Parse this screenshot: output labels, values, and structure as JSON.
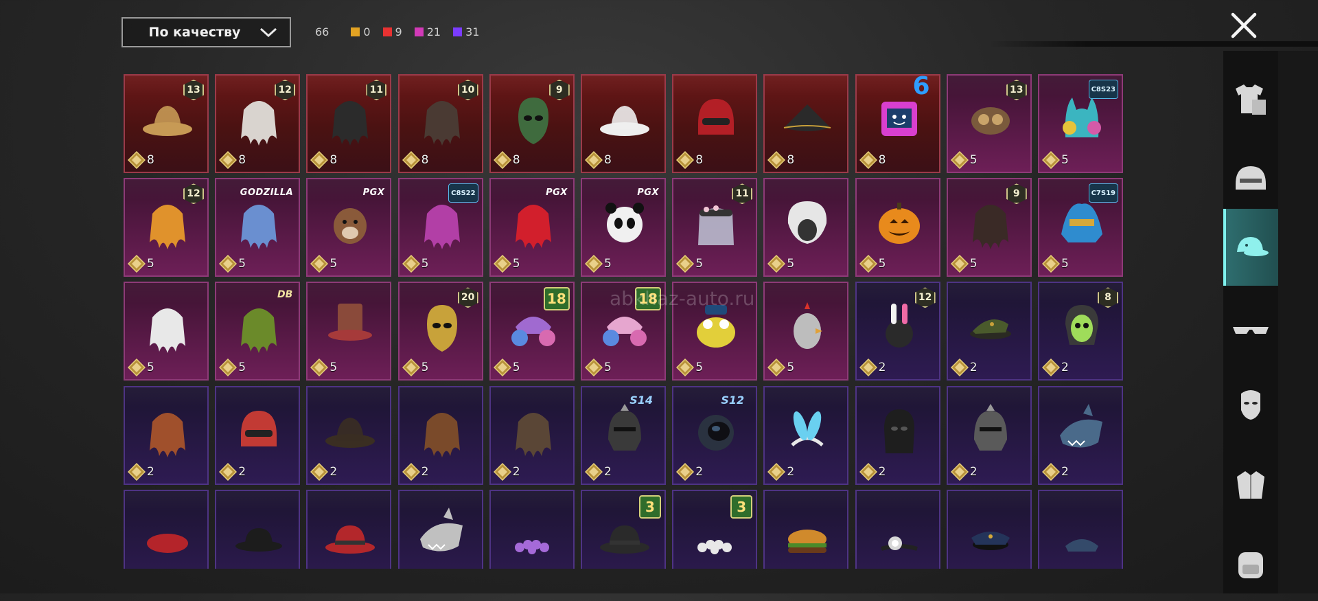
{
  "filter": {
    "label": "По качеству"
  },
  "counts": {
    "total": "66",
    "items": [
      {
        "color": "#e3a323",
        "value": "0"
      },
      {
        "color": "#e83232",
        "value": "9"
      },
      {
        "color": "#d23ab8",
        "value": "21"
      },
      {
        "color": "#7b3cff",
        "value": "31"
      }
    ]
  },
  "watermark": "abkhaz-auto.ru",
  "sidebar": {
    "items": [
      {
        "icon": "outfit-icon",
        "active": false
      },
      {
        "icon": "helmet-icon",
        "active": false
      },
      {
        "icon": "cap-icon",
        "active": true
      },
      {
        "icon": "glasses-icon",
        "active": false
      },
      {
        "icon": "face-icon",
        "active": false
      },
      {
        "icon": "jacket-icon",
        "active": false
      },
      {
        "icon": "backpack-icon",
        "active": false
      }
    ]
  },
  "grid": {
    "rows": [
      [
        {
          "quality": "red",
          "price": "8",
          "badge": "13",
          "badge_type": "level",
          "icon": "hat-icon",
          "color": "#c79a55"
        },
        {
          "quality": "red",
          "price": "8",
          "badge": "12",
          "badge_type": "level",
          "icon": "hair-icon",
          "color": "#d9d4cf"
        },
        {
          "quality": "red",
          "price": "8",
          "badge": "11",
          "badge_type": "level",
          "icon": "hair-icon",
          "color": "#2b2b2b"
        },
        {
          "quality": "red",
          "price": "8",
          "badge": "10",
          "badge_type": "level",
          "icon": "hair-icon",
          "color": "#4a3a33"
        },
        {
          "quality": "red",
          "price": "8",
          "badge": "9",
          "badge_type": "level",
          "icon": "mask-icon",
          "color": "#3f6b3e"
        },
        {
          "quality": "red",
          "price": "8",
          "badge": "",
          "badge_type": "",
          "icon": "hat-icon",
          "color": "#eeeeee"
        },
        {
          "quality": "red",
          "price": "8",
          "badge": "",
          "badge_type": "",
          "icon": "helmet-icon",
          "color": "#b31f26"
        },
        {
          "quality": "red",
          "price": "8",
          "badge": "",
          "badge_type": "",
          "icon": "tricorn-icon",
          "color": "#2a2a2a"
        },
        {
          "quality": "red",
          "price": "8",
          "badge": "6",
          "badge_type": "blue6",
          "icon": "box-head-icon",
          "color": "#d93fcf"
        },
        {
          "quality": "pink",
          "price": "5",
          "badge": "13",
          "badge_type": "level",
          "icon": "goggles-icon",
          "color": "#7a5a3c"
        },
        {
          "quality": "pink",
          "price": "5",
          "badge": "C8S23",
          "badge_type": "season",
          "icon": "cat-hood-icon",
          "color": "#3bb5c0"
        }
      ],
      [
        {
          "quality": "pink",
          "price": "5",
          "badge": "12",
          "badge_type": "level",
          "icon": "hair-icon",
          "color": "#e0922c"
        },
        {
          "quality": "pink",
          "price": "5",
          "badge": "GODZILLA",
          "badge_type": "logo",
          "icon": "hair-icon",
          "color": "#6a8fd0"
        },
        {
          "quality": "pink",
          "price": "5",
          "badge": "PGX",
          "badge_type": "logo",
          "icon": "animal-head-icon",
          "color": "#8a5a3a"
        },
        {
          "quality": "pink",
          "price": "5",
          "badge": "C8S22",
          "badge_type": "season",
          "icon": "hair-icon",
          "color": "#b23fa6"
        },
        {
          "quality": "pink",
          "price": "5",
          "badge": "PGX",
          "badge_type": "logo",
          "icon": "hair-icon",
          "color": "#d21f2c"
        },
        {
          "quality": "pink",
          "price": "5",
          "badge": "PGX",
          "badge_type": "logo",
          "icon": "panda-icon",
          "color": "#f0f0f0"
        },
        {
          "quality": "pink",
          "price": "5",
          "badge": "11",
          "badge_type": "level",
          "icon": "veil-icon",
          "color": "#bfc4d6"
        },
        {
          "quality": "pink",
          "price": "5",
          "badge": "",
          "badge_type": "",
          "icon": "fur-hat-icon",
          "color": "#e6e6e6"
        },
        {
          "quality": "pink",
          "price": "5",
          "badge": "",
          "badge_type": "",
          "icon": "pumpkin-icon",
          "color": "#e88a1c"
        },
        {
          "quality": "pink",
          "price": "5",
          "badge": "9",
          "badge_type": "level",
          "icon": "hair-icon",
          "color": "#3a2a26"
        },
        {
          "quality": "pink",
          "price": "5",
          "badge": "C7S19",
          "badge_type": "season",
          "icon": "headdress-icon",
          "color": "#2f8ccf"
        }
      ],
      [
        {
          "quality": "pink",
          "price": "5",
          "badge": "",
          "badge_type": "",
          "icon": "hair-icon",
          "color": "#e8e8e8"
        },
        {
          "quality": "pink",
          "price": "5",
          "badge": "DB",
          "badge_type": "logo2",
          "icon": "hair-icon",
          "color": "#6b8a2a"
        },
        {
          "quality": "pink",
          "price": "5",
          "badge": "",
          "badge_type": "",
          "icon": "top-hat-icon",
          "color": "#8a4a3a"
        },
        {
          "quality": "pink",
          "price": "5",
          "badge": "20",
          "badge_type": "level",
          "icon": "mask-icon",
          "color": "#c8a23a"
        },
        {
          "quality": "pink",
          "price": "5",
          "badge": "18",
          "badge_type": "big",
          "icon": "headphones-hat-icon",
          "color": "#a06ad0"
        },
        {
          "quality": "pink",
          "price": "5",
          "badge": "18",
          "badge_type": "big",
          "icon": "headphones-hat-icon",
          "color": "#e6a6cf"
        },
        {
          "quality": "pink",
          "price": "5",
          "badge": "",
          "badge_type": "",
          "icon": "frog-head-icon",
          "color": "#e2cf3a"
        },
        {
          "quality": "pink",
          "price": "5",
          "badge": "",
          "badge_type": "",
          "icon": "chicken-head-icon",
          "color": "#bdbdbd"
        },
        {
          "quality": "purple",
          "price": "2",
          "badge": "12",
          "badge_type": "level",
          "icon": "bunny-helmet-icon",
          "color": "#2a2a2a"
        },
        {
          "quality": "purple",
          "price": "2",
          "badge": "",
          "badge_type": "",
          "icon": "military-cap-icon",
          "color": "#4a5a2c"
        },
        {
          "quality": "purple",
          "price": "2",
          "badge": "8",
          "badge_type": "level",
          "icon": "skull-icon",
          "color": "#9fdc5a"
        }
      ],
      [
        {
          "quality": "purple",
          "price": "2",
          "badge": "",
          "badge_type": "",
          "icon": "hair-icon",
          "color": "#a0502c"
        },
        {
          "quality": "purple",
          "price": "2",
          "badge": "",
          "badge_type": "",
          "icon": "helmet-icon",
          "color": "#c23a34"
        },
        {
          "quality": "purple",
          "price": "2",
          "badge": "",
          "badge_type": "",
          "icon": "hat-icon",
          "color": "#3a2e22"
        },
        {
          "quality": "purple",
          "price": "2",
          "badge": "",
          "badge_type": "",
          "icon": "hair-icon",
          "color": "#7a4a2a"
        },
        {
          "quality": "purple",
          "price": "2",
          "badge": "",
          "badge_type": "",
          "icon": "hair-icon",
          "color": "#5a4636"
        },
        {
          "quality": "purple",
          "price": "2",
          "badge": "S14",
          "badge_type": "wing",
          "icon": "knight-helmet-icon",
          "color": "#3a3a3a"
        },
        {
          "quality": "purple",
          "price": "2",
          "badge": "S12",
          "badge_type": "wing",
          "icon": "space-helmet-icon",
          "color": "#2a3240"
        },
        {
          "quality": "purple",
          "price": "2",
          "badge": "",
          "badge_type": "",
          "icon": "bunny-ears-icon",
          "color": "#6ad0f0"
        },
        {
          "quality": "purple",
          "price": "2",
          "badge": "",
          "badge_type": "",
          "icon": "balaclava-icon",
          "color": "#1e1e1e"
        },
        {
          "quality": "purple",
          "price": "2",
          "badge": "",
          "badge_type": "",
          "icon": "knight-helmet-icon",
          "color": "#5a5a5a"
        },
        {
          "quality": "purple",
          "price": "2",
          "badge": "",
          "badge_type": "",
          "icon": "shark-hat-icon",
          "color": "#4a6a8a"
        }
      ],
      [
        {
          "quality": "purple",
          "price": "",
          "badge": "",
          "badge_type": "",
          "icon": "beret-icon",
          "color": "#b4242a"
        },
        {
          "quality": "purple",
          "price": "",
          "badge": "",
          "badge_type": "",
          "icon": "bowler-hat-icon",
          "color": "#1c1c1c"
        },
        {
          "quality": "purple",
          "price": "",
          "badge": "",
          "badge_type": "",
          "icon": "fedora-icon",
          "color": "#b3272b"
        },
        {
          "quality": "purple",
          "price": "",
          "badge": "",
          "badge_type": "",
          "icon": "shark-hat-icon",
          "color": "#c0c0c0"
        },
        {
          "quality": "purple",
          "price": "",
          "badge": "",
          "badge_type": "",
          "icon": "flower-crown-icon",
          "color": "#a56ad8"
        },
        {
          "quality": "purple",
          "price": "",
          "badge": "3",
          "badge_type": "big",
          "icon": "fedora-icon",
          "color": "#2a2a2a"
        },
        {
          "quality": "purple",
          "price": "",
          "badge": "3",
          "badge_type": "big",
          "icon": "flower-crown-icon",
          "color": "#e8e8e8"
        },
        {
          "quality": "purple",
          "price": "",
          "badge": "",
          "badge_type": "",
          "icon": "burger-hat-icon",
          "color": "#d08a2c"
        },
        {
          "quality": "purple",
          "price": "",
          "badge": "",
          "badge_type": "",
          "icon": "headlamp-icon",
          "color": "#d8d8d8"
        },
        {
          "quality": "purple",
          "price": "",
          "badge": "",
          "badge_type": "",
          "icon": "pilot-cap-icon",
          "color": "#24345a"
        },
        {
          "quality": "purple",
          "price": "",
          "badge": "",
          "badge_type": "",
          "icon": "sailor-cap-icon",
          "color": "#344a6a"
        }
      ]
    ]
  }
}
